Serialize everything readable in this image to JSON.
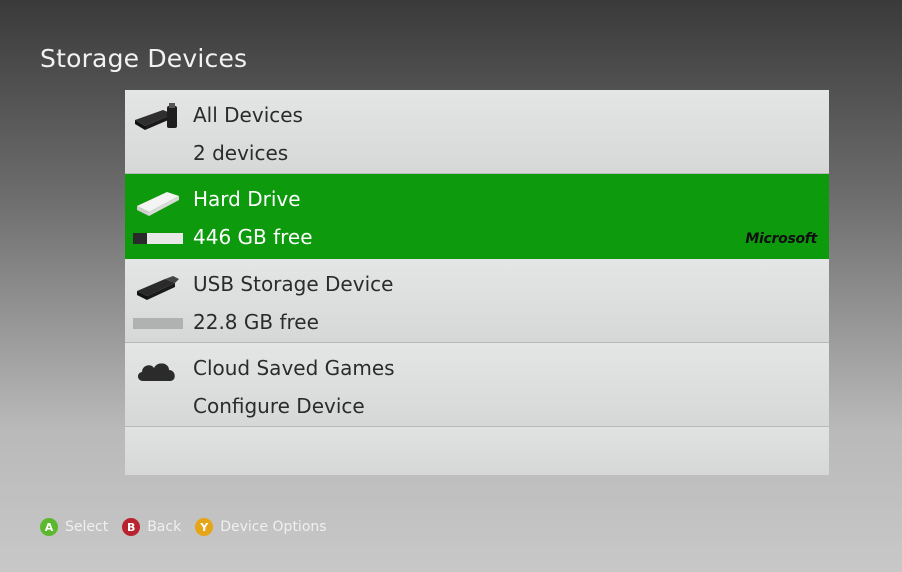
{
  "header": {
    "title": "Storage Devices"
  },
  "devices": [
    {
      "name": "All Devices",
      "detail": "2 devices",
      "icon": "all-devices-icon",
      "selected": false
    },
    {
      "name": "Hard Drive",
      "detail": "446 GB free",
      "icon": "hard-drive-icon",
      "selected": true,
      "usage_fraction": 0.28,
      "brand": "Microsoft"
    },
    {
      "name": "USB Storage Device",
      "detail": "22.8 GB free",
      "icon": "usb-drive-icon",
      "selected": false,
      "usage_fraction": 0.0
    },
    {
      "name": "Cloud Saved Games",
      "detail": "Configure Device",
      "icon": "cloud-icon",
      "selected": false
    }
  ],
  "footer": {
    "hints": [
      {
        "key": "A",
        "label": "Select",
        "color": "#5cb82e"
      },
      {
        "key": "B",
        "label": "Back",
        "color": "#b8232e"
      },
      {
        "key": "Y",
        "label": "Device Options",
        "color": "#e6a417"
      }
    ]
  },
  "colors": {
    "selected_row": "#0d9b0d",
    "list_bg": "#dcdede"
  }
}
